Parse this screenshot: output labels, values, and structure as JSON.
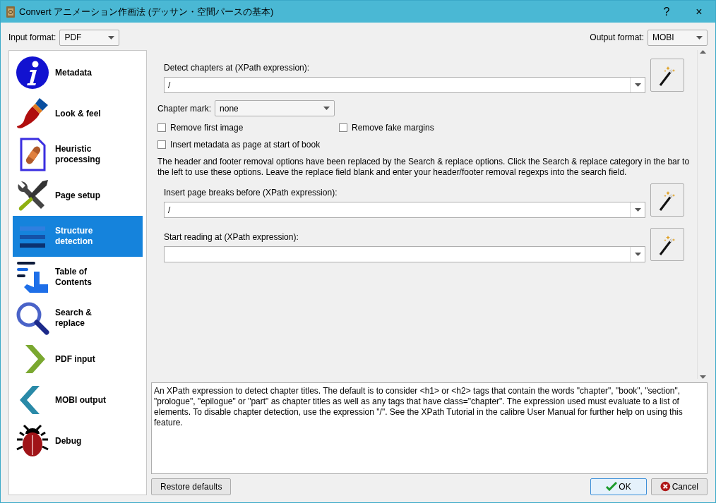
{
  "window": {
    "title": "Convert アニメーション作画法 (デッサン・空間パースの基本)",
    "buttons": [
      "?",
      "×"
    ]
  },
  "input_format": {
    "label": "Input format:",
    "value": "PDF"
  },
  "output_format": {
    "label": "Output format:",
    "value": "MOBI"
  },
  "sidebar": {
    "items": [
      {
        "label": "Metadata",
        "selected": false
      },
      {
        "label": "Look & feel",
        "selected": false
      },
      {
        "label": "Heuristic processing",
        "selected": false
      },
      {
        "label": "Page setup",
        "selected": false
      },
      {
        "label": "Structure detection",
        "selected": true
      },
      {
        "label": "Table of Contents",
        "selected": false
      },
      {
        "label": "Search & replace",
        "selected": false
      },
      {
        "label": "PDF input",
        "selected": false
      },
      {
        "label": "MOBI output",
        "selected": false
      },
      {
        "label": "Debug",
        "selected": false
      }
    ]
  },
  "detect_chapters": {
    "label": "Detect chapters at (XPath expression):",
    "value": "/"
  },
  "chapter_mark": {
    "label": "Chapter mark:",
    "value": "none"
  },
  "checkboxes": [
    {
      "label": "Remove first image",
      "checked": false
    },
    {
      "label": "Remove fake margins",
      "checked": false
    },
    {
      "label": "Insert metadata as page at start of book",
      "checked": false
    }
  ],
  "note": "The header and footer removal options have been replaced by the Search & replace options. Click the Search & replace category in the bar to the left to use these options. Leave the replace field blank and enter your header/footer removal regexps into the search field.",
  "page_breaks": {
    "label": "Insert page breaks before (XPath expression):",
    "value": "/"
  },
  "start_reading": {
    "label": "Start reading at (XPath expression):"
  },
  "help_text": "An XPath expression to detect chapter titles. The default is to consider <h1> or <h2> tags that contain the words \"chapter\", \"book\", \"section\", \"prologue\", \"epilogue\" or \"part\" as chapter titles as well as any tags that have class=\"chapter\". The expression used must evaluate to a list of elements. To disable chapter detection, use the expression \"/\". See the XPath Tutorial in the calibre User Manual for further help on using this feature.",
  "buttons": {
    "restore": "Restore defaults",
    "ok": "OK",
    "cancel": "Cancel"
  }
}
